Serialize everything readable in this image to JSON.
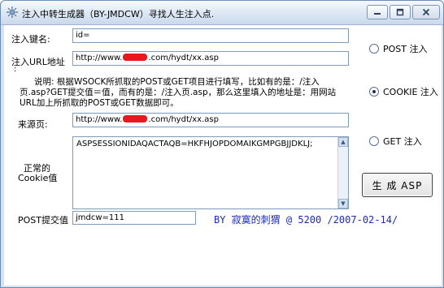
{
  "window": {
    "title": "注入中转生成器（BY-JMDCW）寻找人生注入点."
  },
  "form": {
    "key_label": "注入键名:",
    "key_value": "id=",
    "url_label": "注入URL地址",
    "url_colon": ":",
    "url_value_prefix": "http://www.",
    "url_value_suffix": ".com/hydt/xx.asp",
    "description": "说明: 根据WSOCK所抓取的POST或GET项目进行填写，比如有的是：/注入页.asp?GET提交值＝值，而有的是：/注入页.asp，那么这里填入的地址是：用网站URL加上所抓取的POST或GET数据即可。",
    "referer_label": "来源页:",
    "referer_value_prefix": "http://www.",
    "referer_value_suffix": ".com/hydt/xx.asp",
    "cookie_label_line1": "正常的",
    "cookie_label_line2": "Cookie值",
    "cookie_value": "ASPSESSIONIDAQACTAQB=HKFHJOPDOMAIKGMPGBJJDKLJ;",
    "post_label": "POST提交值",
    "post_value": "jmdcw=111"
  },
  "options": [
    {
      "label": "POST 注入",
      "selected": false
    },
    {
      "label": "COOKIE 注入",
      "selected": true
    },
    {
      "label": "GET 注入",
      "selected": false
    }
  ],
  "generate_button": "生 成 ASP",
  "credit": "BY 寂寞的刺猬 @ 5200  /2007-02-14/",
  "colors": {
    "credit_text": "#1a2bb8",
    "redaction": "#e8191e"
  }
}
